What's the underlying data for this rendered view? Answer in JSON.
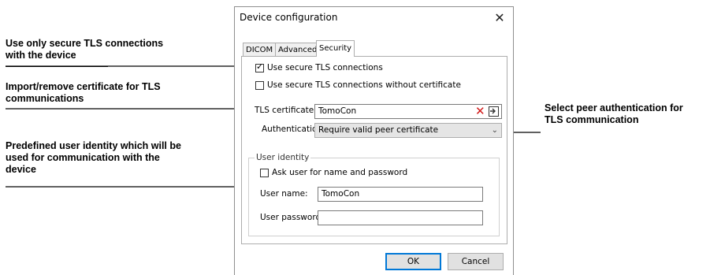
{
  "annotations": {
    "secure_tls": [
      "Use only secure TLS connections",
      "with the device"
    ],
    "import_cert": [
      "Import/remove certificate for TLS",
      "communications"
    ],
    "peer_auth": [
      "Select peer authentication for",
      "TLS communication"
    ],
    "user_identity": [
      "Predefined user identity which will be",
      "used for communication with the",
      "device"
    ]
  },
  "dialog": {
    "title": "Device configuration",
    "close_glyph": "✕",
    "tabs": [
      "DICOM",
      "Advanced",
      "Security"
    ],
    "active_tab": "Security",
    "use_secure_tls": {
      "label": "Use secure TLS connections",
      "checked": true
    },
    "use_tls_without_cert": {
      "label": "Use secure TLS connections without certificate",
      "checked": false
    },
    "tls_certificate": {
      "label": "TLS certificate:",
      "value": "TomoCon"
    },
    "authentication": {
      "label": "Authentication:",
      "value": "Require valid peer certificate"
    },
    "user_identity": {
      "group_title": "User identity",
      "ask_user": {
        "label": "Ask user for name and password",
        "checked": false
      },
      "user_name": {
        "label": "User name:",
        "value": "TomoCon"
      },
      "user_password": {
        "label": "User password:",
        "value": ""
      }
    },
    "buttons": {
      "ok": "OK",
      "cancel": "Cancel"
    }
  },
  "icons": {
    "remove_certificate": "remove-icon",
    "import_certificate": "import-icon"
  },
  "colors": {
    "remove_icon": "#d21a1a",
    "default_button_border": "#0078d7"
  }
}
